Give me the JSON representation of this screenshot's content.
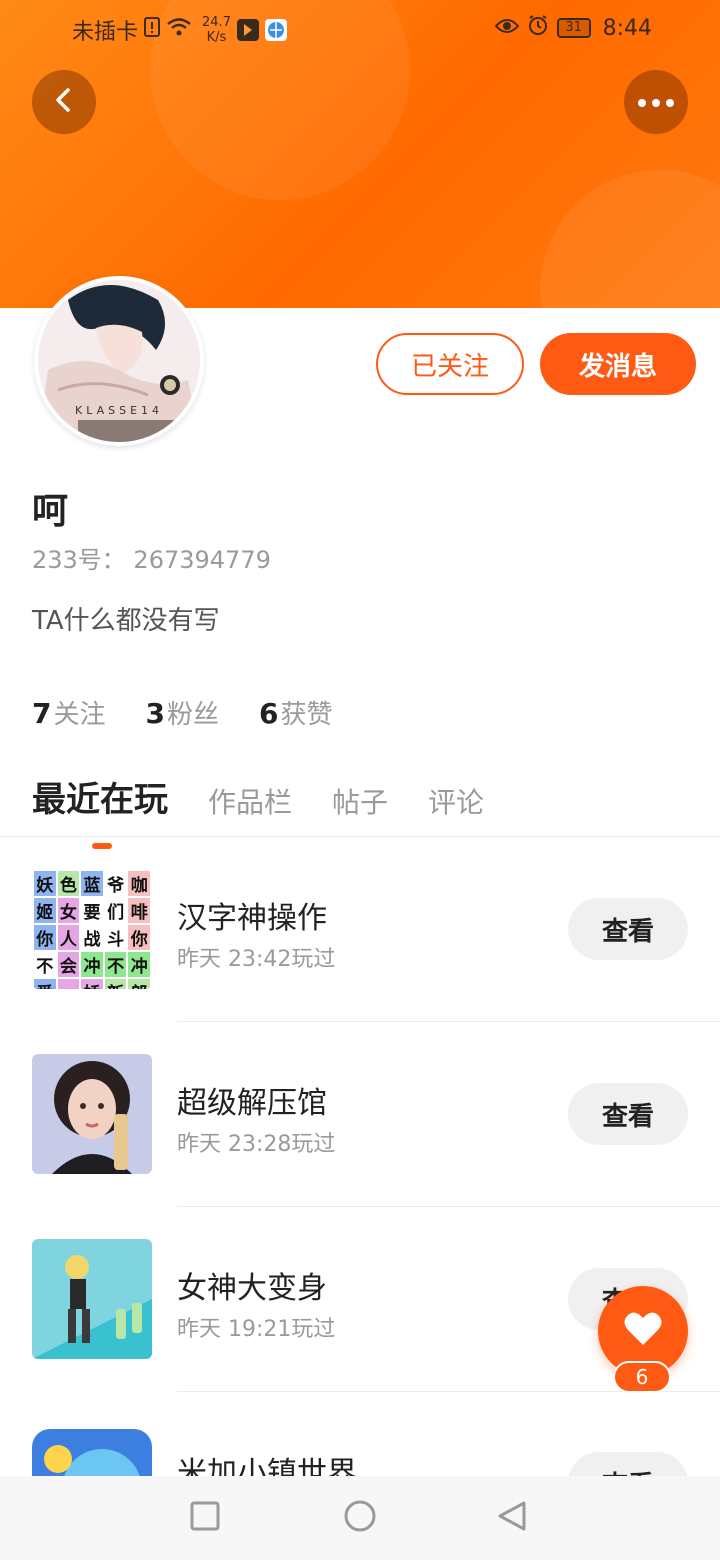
{
  "status_bar": {
    "carrier": "未插卡",
    "speed_top": "24.7",
    "speed_bottom": "K/s",
    "battery": "31",
    "time": "8:44"
  },
  "profile": {
    "avatar_caption": "KLASSE14",
    "follow_label": "已关注",
    "message_label": "发消息",
    "name": "呵",
    "id_text": "233号： 267394779",
    "bio": "TA什么都没有写",
    "stats": [
      {
        "num": "7",
        "label": "关注"
      },
      {
        "num": "3",
        "label": "粉丝"
      },
      {
        "num": "6",
        "label": "获赞"
      }
    ]
  },
  "tabs": [
    "最近在玩",
    "作品栏",
    "帖子",
    "评论"
  ],
  "games": [
    {
      "title": "汉字神操作",
      "time": "昨天 23:42玩过",
      "action": "查看"
    },
    {
      "title": "超级解压馆",
      "time": "昨天 23:28玩过",
      "action": "查看"
    },
    {
      "title": "女神大变身",
      "time": "昨天 19:21玩过",
      "action": "查看"
    },
    {
      "title": "米加小镇世界",
      "time": "",
      "action": "查看"
    }
  ],
  "grid_chars": [
    "妖",
    "色",
    "蓝",
    "爷",
    "咖",
    "姬",
    "女",
    "要",
    "们",
    "啡",
    "你",
    "人",
    "战",
    "斗",
    "你",
    "不",
    "会",
    "冲",
    "不",
    "冲",
    "爱",
    "",
    "娇",
    "新",
    "郎"
  ],
  "like_count": "6",
  "colors": {
    "accent": "#ff5a14",
    "banner": "#ff7a10"
  }
}
